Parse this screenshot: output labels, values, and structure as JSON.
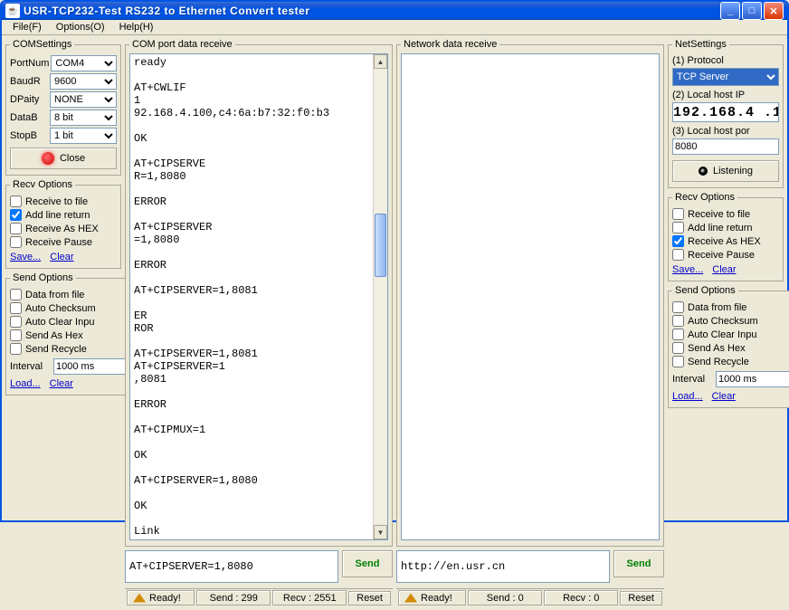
{
  "window": {
    "title": "USR-TCP232-Test   RS232 to Ethernet Convert tester"
  },
  "menu": {
    "file": "File(F)",
    "options": "Options(O)",
    "help": "Help(H)"
  },
  "com": {
    "legend": "COMSettings",
    "portnum_label": "PortNum",
    "portnum": "COM4",
    "baud_label": "BaudR",
    "baud": "9600",
    "parity_label": "DPaity",
    "parity": "NONE",
    "datab_label": "DataB",
    "datab": "8 bit",
    "stopb_label": "StopB",
    "stopb": "1 bit",
    "close": "Close"
  },
  "net": {
    "legend": "NetSettings",
    "proto_label": "(1) Protocol",
    "proto": "TCP Server",
    "ip_label": "(2) Local host IP",
    "ip": "192.168.4 .1",
    "port_label": "(3) Local host por",
    "port": "8080",
    "listen": "Listening"
  },
  "recv_opts": {
    "legend": "Recv Options",
    "to_file": "Receive to file",
    "add_ret": "Add line return",
    "as_hex": "Receive As HEX",
    "pause": "Receive Pause",
    "save": "Save...",
    "clear": "Clear"
  },
  "send_opts": {
    "legend": "Send Options",
    "from_file": "Data from file",
    "checksum": "Auto Checksum",
    "clear_inp": "Auto Clear Inpu",
    "as_hex": "Send As Hex",
    "recycle": "Send Recycle",
    "interval_label": "Interval",
    "interval": "1000 ms",
    "load": "Load...",
    "clear": "Clear"
  },
  "com_recv_legend": "COM port data receive",
  "net_recv_legend": "Network data receive",
  "com_data": "ready\n\nAT+CWLIF\n1\n92.168.4.100,c4:6a:b7:32:f0:b3\n\nOK\n\nAT+CIPSERVE\nR=1,8080\n\nERROR\n\nAT+CIPSERVER\n=1,8080\n\nERROR\n\nAT+CIPSERVER=1,8081\n\nER\nROR\n\nAT+CIPSERVER=1,8081\nAT+CIPSERVER=1\n,8081\n\nERROR\n\nAT+CIPMUX=1\n\nOK\n\nAT+CIPSERVER=1,8080\n\nOK\n\nLink",
  "com_send_input": "AT+CIPSERVER=1,8080",
  "net_send_input": "http://en.usr.cn",
  "send_btn": "Send",
  "status": {
    "ready": "Ready!",
    "com_send": "Send : 299",
    "com_recv": "Recv : 2551",
    "net_send": "Send : 0",
    "net_recv": "Recv : 0",
    "reset": "Reset"
  }
}
